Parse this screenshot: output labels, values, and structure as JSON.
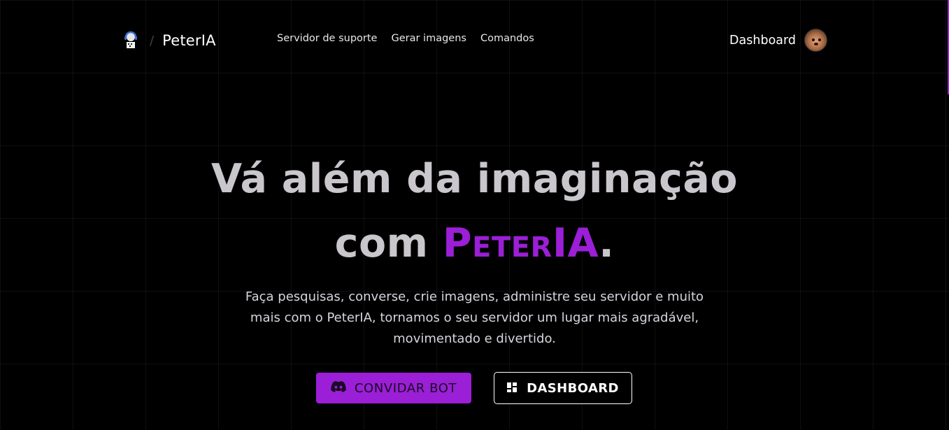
{
  "header": {
    "brand": "PeterIA",
    "separator": "/",
    "nav": [
      {
        "label": "Servidor de suporte"
      },
      {
        "label": "Gerar imagens"
      },
      {
        "label": "Comandos"
      }
    ],
    "account_link": "Dashboard",
    "icons": {
      "logo": "peteria-logo-icon",
      "avatar": "user-avatar"
    }
  },
  "hero": {
    "title_line1": "Vá além da imaginação",
    "title_line2_prefix": "com ",
    "title_accent": "PeterIA",
    "title_suffix": ".",
    "subtitle": "Faça pesquisas, converse, crie imagens, administre seu servidor e muito mais com o PeterIA, tornamos o seu servidor um lugar mais agradável, movimentado e divertido."
  },
  "buttons": {
    "invite_label": "CONVIDAR BOT",
    "invite_icon": "discord-icon",
    "dashboard_label": "DASHBOARD",
    "dashboard_icon": "dashboard-grid-icon"
  },
  "colors": {
    "accent": "#9b1fd6",
    "background": "#000000",
    "title_text": "#c9c6cc"
  }
}
